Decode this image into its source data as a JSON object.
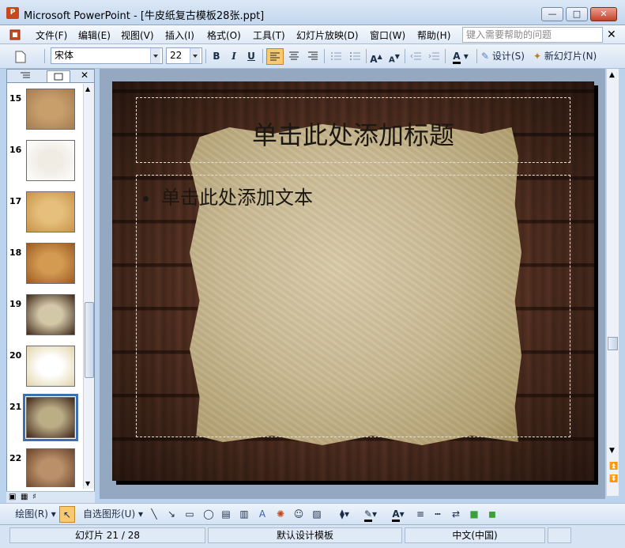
{
  "window": {
    "title": "Microsoft PowerPoint - [牛皮纸复古模板28张.ppt]",
    "app_icon_label": "P",
    "minimize_label": "—",
    "restore_label": "□",
    "close_label": "✕"
  },
  "menu": {
    "items": [
      "文件(F)",
      "编辑(E)",
      "视图(V)",
      "插入(I)",
      "格式(O)",
      "工具(T)",
      "幻灯片放映(D)",
      "窗口(W)",
      "帮助(H)"
    ],
    "help_placeholder": "键入需要帮助的问题",
    "close_label": "✕"
  },
  "toolbar": {
    "font_name": "宋体",
    "font_size": "22",
    "bold_label": "B",
    "italic_label": "I",
    "underline_label": "U",
    "design_label": "设计(S)",
    "new_slide_label": "新幻灯片(N)"
  },
  "pane": {
    "close_label": "✕",
    "slides": [
      {
        "num": "15",
        "bg": "#a57c52",
        "inner": "#c89f6b"
      },
      {
        "num": "16",
        "bg": "#ffffff",
        "inner": "#f0ece4"
      },
      {
        "num": "17",
        "bg": "#c99248",
        "inner": "#e5c07c"
      },
      {
        "num": "18",
        "bg": "#9a5a22",
        "inner": "#d39b52"
      },
      {
        "num": "19",
        "bg": "#3d2718",
        "inner": "#d2c7a6"
      },
      {
        "num": "20",
        "bg": "#e2d3a8",
        "inner": "#ffffff"
      },
      {
        "num": "21",
        "bg": "#3e2418",
        "inner": "#bbae86"
      },
      {
        "num": "22",
        "bg": "#6a432a",
        "inner": "#b9906a"
      }
    ],
    "selected_slide": "21"
  },
  "slide": {
    "title_placeholder": "单击此处添加标题",
    "body_placeholder": "单击此处添加文本"
  },
  "drawbar": {
    "draw_label": "绘图(R)",
    "autoshapes_label": "自选图形(U)"
  },
  "status": {
    "slide_info": "幻灯片 21 / 28",
    "design": "默认设计模板",
    "language": "中文(中国)"
  }
}
